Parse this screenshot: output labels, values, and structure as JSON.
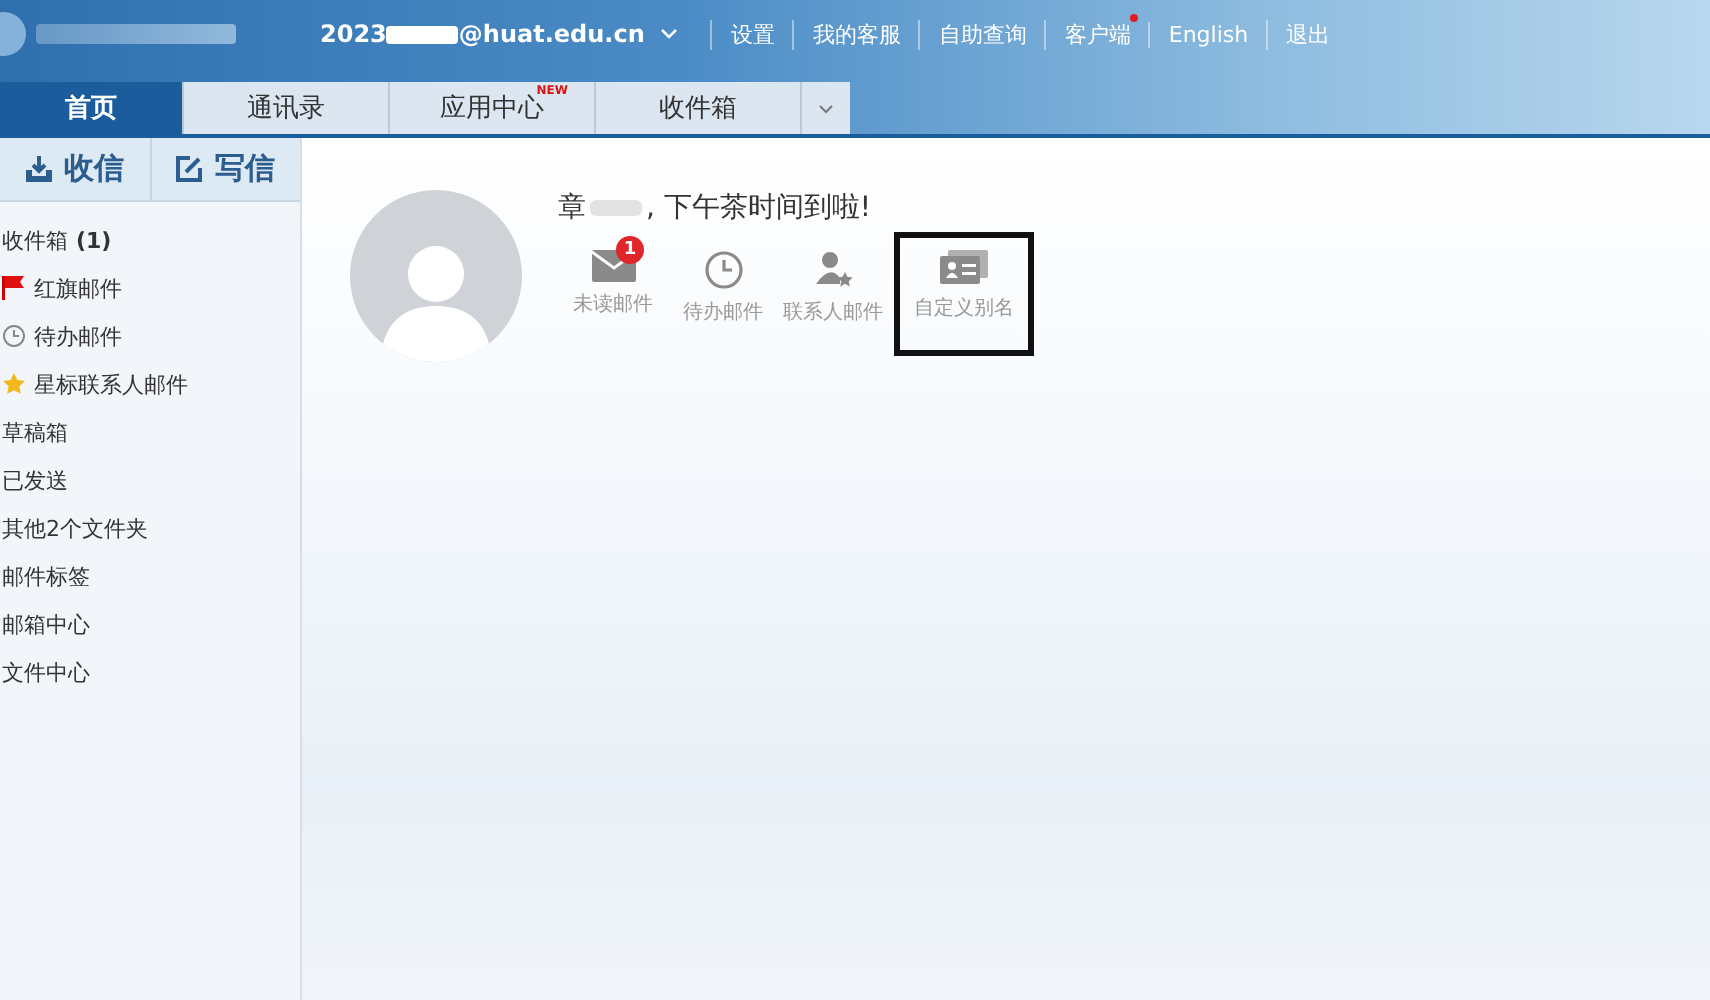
{
  "header": {
    "account": {
      "prefix": "2023",
      "suffix": "@huat.edu.cn"
    },
    "links": [
      {
        "label": "设置",
        "badge": false
      },
      {
        "label": "我的客服",
        "badge": false
      },
      {
        "label": "自助查询",
        "badge": false
      },
      {
        "label": "客户端",
        "badge": true
      },
      {
        "label": "English",
        "badge": false
      },
      {
        "label": "退出",
        "badge": false
      }
    ]
  },
  "tabs": [
    {
      "label": "首页",
      "selected": true
    },
    {
      "label": "通讯录",
      "selected": false
    },
    {
      "label": "应用中心",
      "selected": false,
      "badge": "NEW"
    },
    {
      "label": "收件箱",
      "selected": false
    }
  ],
  "sidebar": {
    "actions": [
      {
        "label": "收信",
        "kind": "receive"
      },
      {
        "label": "写信",
        "kind": "compose"
      }
    ],
    "items": [
      {
        "label": "收件箱",
        "count": "(1)",
        "kind": "plain"
      },
      {
        "label": "红旗邮件",
        "kind": "flag"
      },
      {
        "label": "待办邮件",
        "kind": "clock"
      },
      {
        "label": "星标联系人邮件",
        "kind": "star"
      },
      {
        "label": "草稿箱",
        "kind": "plain"
      },
      {
        "label": "已发送",
        "kind": "plain"
      },
      {
        "label": "其他2个文件夹",
        "kind": "plain"
      },
      {
        "label": "邮件标签",
        "kind": "plain"
      },
      {
        "label": "邮箱中心",
        "kind": "plain"
      },
      {
        "label": "文件中心",
        "kind": "plain"
      }
    ]
  },
  "welcome": {
    "name_start": "章",
    "greeting": ", 下午茶时间到啦!",
    "shortcuts": [
      {
        "label": "未读邮件",
        "kind": "mail",
        "badge": "1",
        "highlighted": false
      },
      {
        "label": "待办邮件",
        "kind": "clock",
        "highlighted": false
      },
      {
        "label": "联系人邮件",
        "kind": "contact",
        "highlighted": false
      },
      {
        "label": "自定义别名",
        "kind": "card",
        "highlighted": true
      }
    ]
  }
}
